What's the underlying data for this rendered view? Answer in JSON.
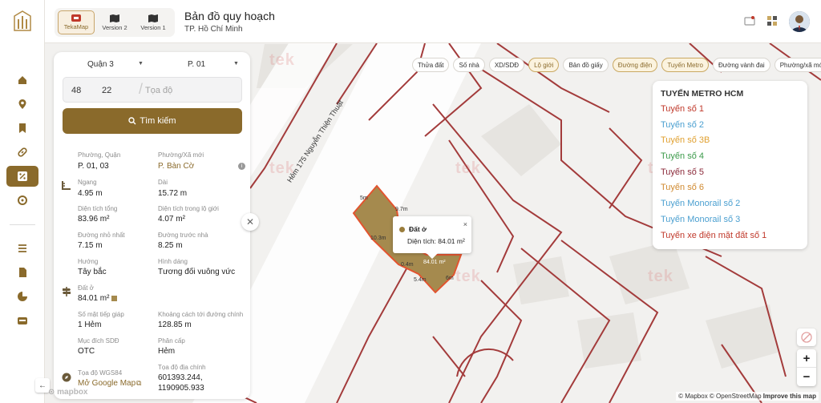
{
  "header": {
    "title": "Bản đồ quy hoạch",
    "subtitle": "TP. Hồ Chí Minh",
    "versions": [
      {
        "label": "TekaMap",
        "active": true
      },
      {
        "label": "Version 2",
        "active": false
      },
      {
        "label": "Version 1",
        "active": false
      }
    ]
  },
  "panel": {
    "district": "Quận 3",
    "ward": "P. 01",
    "coord1": "48",
    "coord2": "22",
    "coord_placeholder": "Tọa độ",
    "search_label": "Tìm kiếm",
    "fields": {
      "ward_old_label": "Phường, Quận",
      "ward_old_value": "P. 01, 03",
      "ward_new_label": "Phường/Xã mới",
      "ward_new_value": "P. Bàn Cờ",
      "width_label": "Ngang",
      "width_value": "4.95 m",
      "length_label": "Dài",
      "length_value": "15.72 m",
      "total_area_label": "Diện tích tổng",
      "total_area_value": "83.96 m²",
      "area_in_limit_label": "Diện tích trong lộ giới",
      "area_in_limit_value": "4.07 m²",
      "min_road_label": "Đường nhỏ nhất",
      "min_road_value": "7.15 m",
      "front_road_label": "Đường trước nhà",
      "front_road_value": "8.25 m",
      "direction_label": "Hướng",
      "direction_value": "Tây bắc",
      "shape_label": "Hình dáng",
      "shape_value": "Tương đối vuông vức",
      "land_type_label": "Đất ở",
      "land_type_value": "84.01 m²",
      "frontage_label": "Số mặt tiếp giáp",
      "frontage_value": "1 Hẻm",
      "distance_label": "Khoảng cách tới đường chính",
      "distance_value": "128.85 m",
      "purpose_label": "Mục đích SDĐ",
      "purpose_value": "OTC",
      "level_label": "Phân cấp",
      "level_value": "Hẻm",
      "wgs_label": "Tọa độ WGS84",
      "wgs_link": "Mở Google Map",
      "cadastral_label": "Tọa độ địa chính",
      "cadastral_value1": "601393.244,",
      "cadastral_value2": "1190905.933"
    }
  },
  "chips": [
    "Thửa đất",
    "Số nhà",
    "XD/SDĐ",
    "Lộ giới",
    "Bản đồ giấy",
    "Đường điện",
    "Tuyến Metro",
    "Đường vành đai",
    "Phường/xã mới"
  ],
  "legend": {
    "title": "TUYẾN METRO HCM",
    "items": [
      {
        "label": "Tuyến số 1",
        "color": "#c0392b"
      },
      {
        "label": "Tuyến số 2",
        "color": "#4a9fd0"
      },
      {
        "label": "Tuyến số 3B",
        "color": "#e0a030"
      },
      {
        "label": "Tuyến số 4",
        "color": "#3b9a4a"
      },
      {
        "label": "Tuyến số 5",
        "color": "#8b2a3a"
      },
      {
        "label": "Tuyến số 6",
        "color": "#d08a30"
      },
      {
        "label": "Tuyến Monorail số 2",
        "color": "#4a9fd0"
      },
      {
        "label": "Tuyến Monorail số 3",
        "color": "#4a9fd0"
      },
      {
        "label": "Tuyến xe điện mặt đất số 1",
        "color": "#c0392b"
      }
    ]
  },
  "popup": {
    "title": "Đất ở",
    "area_text": "Diện tích: 84.01 m²",
    "close": "×"
  },
  "map_labels": {
    "street": "Hẻm 175 Nguyễn Thiện Thuật",
    "dim_5m": "5m",
    "dim_9_7": "9.7m",
    "dim_10_3": "10.3m",
    "dim_0_4": "0.4m",
    "dim_5_4": "5.4m",
    "dim_6m": "6m",
    "parcel_area": "84.01 m²",
    "watermark": "tek"
  },
  "attribution": {
    "mapbox": "© Mapbox",
    "osm": "© OpenStreetMap",
    "improve": "Improve this map"
  },
  "colors": {
    "brand": "#8a6a2b",
    "road_line": "#a33b3b",
    "parcel": "#a58a4e",
    "parcel_outline": "#e2542f"
  }
}
